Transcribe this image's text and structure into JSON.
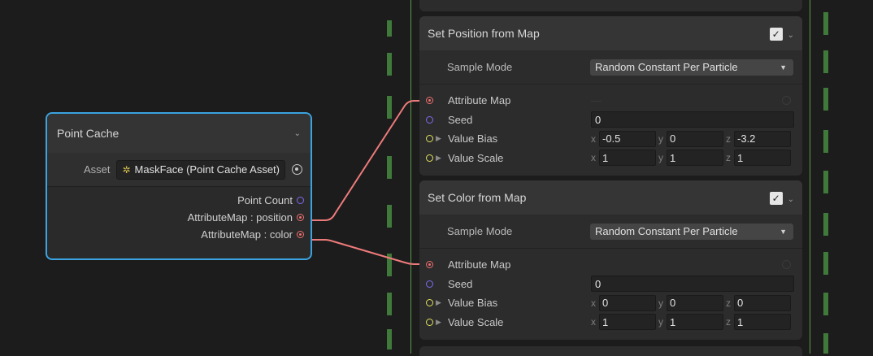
{
  "point_cache": {
    "title": "Point Cache",
    "asset_label": "Asset",
    "asset_value": "MaskFace (Point Cache Asset)",
    "outputs": [
      {
        "label": "Point Count",
        "port": "purple"
      },
      {
        "label": "AttributeMap : position",
        "port": "red"
      },
      {
        "label": "AttributeMap : color",
        "port": "red"
      }
    ]
  },
  "blocks": [
    {
      "title": "Set Position from Map",
      "sample_mode_label": "Sample Mode",
      "sample_mode_value": "Random Constant Per Particle",
      "attribute_map_label": "Attribute Map",
      "seed_label": "Seed",
      "seed_value": "0",
      "bias_label": "Value Bias",
      "bias": {
        "x": "-0.5",
        "y": "0",
        "z": "-3.2"
      },
      "scale_label": "Value Scale",
      "scale": {
        "x": "1",
        "y": "1",
        "z": "1"
      }
    },
    {
      "title": "Set Color from Map",
      "sample_mode_label": "Sample Mode",
      "sample_mode_value": "Random Constant Per Particle",
      "attribute_map_label": "Attribute Map",
      "seed_label": "Seed",
      "seed_value": "0",
      "bias_label": "Value Bias",
      "bias": {
        "x": "0",
        "y": "0",
        "z": "0"
      },
      "scale_label": "Value Scale",
      "scale": {
        "x": "1",
        "y": "1",
        "z": "1"
      }
    }
  ],
  "axis_labels": {
    "x": "x",
    "y": "y",
    "z": "z"
  },
  "icons": {
    "checkbox": "checkmark-icon",
    "collapse": "chevron-down-icon",
    "dropdown": "dropdown-arrow-icon",
    "asset": "point-cache-asset-icon",
    "picker": "object-picker-icon"
  },
  "colors": {
    "selection": "#3ba3df",
    "edge": "#ee7b7b",
    "flow": "#3f7a3a",
    "port_position": "#ee6f6f",
    "port_float": "#7b6cf2",
    "port_vector": "#e2e25a"
  }
}
